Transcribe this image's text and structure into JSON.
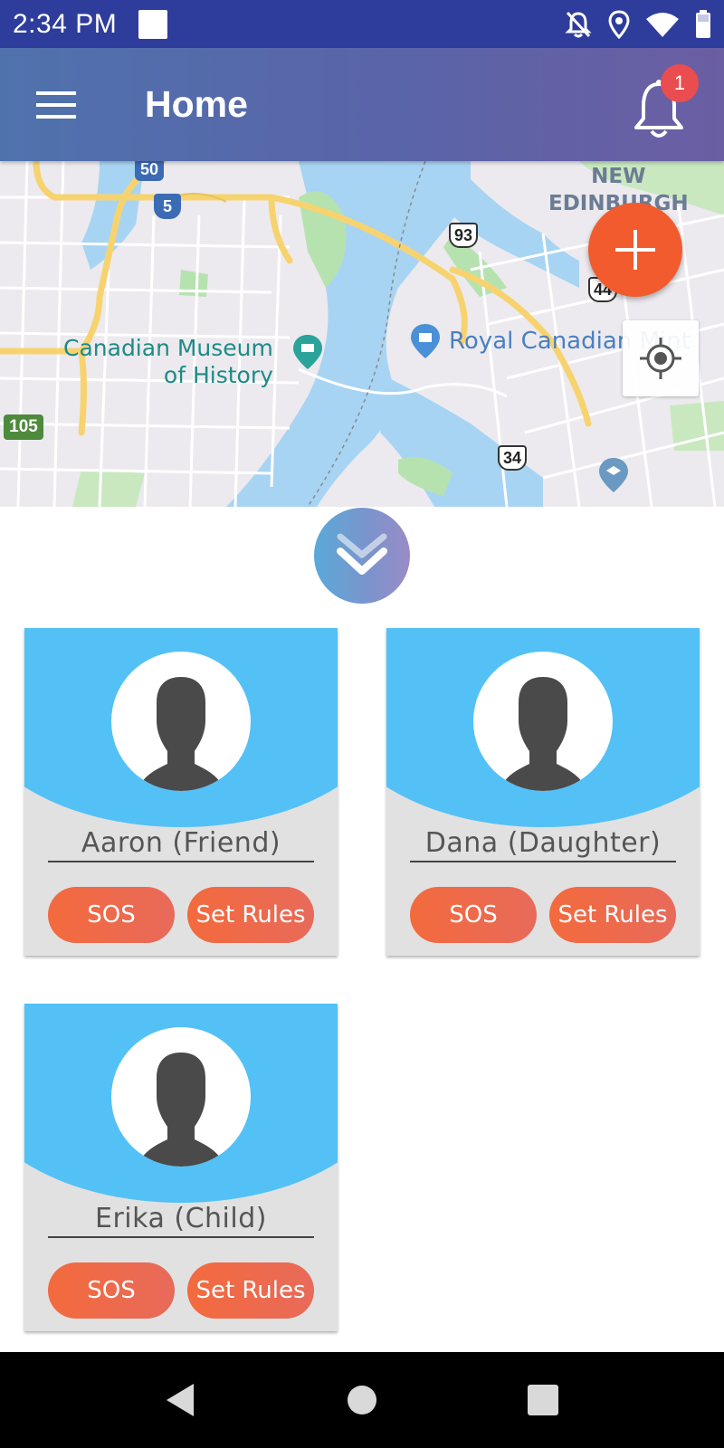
{
  "status_bar": {
    "time": "2:34 PM",
    "icons": [
      "notifications-off-icon",
      "location-icon",
      "wifi-icon",
      "battery-icon"
    ]
  },
  "app_bar": {
    "title": "Home",
    "notification_count": "1"
  },
  "map": {
    "labels": {
      "new_edinburgh": "NEW\nEDINBURGH",
      "museum": "Canadian Museum\nof History",
      "royal": "Royal Canadian Mint"
    },
    "highways": [
      "50",
      "5",
      "93",
      "44",
      "105",
      "34"
    ]
  },
  "contacts": [
    {
      "name": "Aaron (Friend)",
      "sos_label": "SOS",
      "rules_label": "Set Rules"
    },
    {
      "name": "Dana (Daughter)",
      "sos_label": "SOS",
      "rules_label": "Set Rules"
    },
    {
      "name": "Erika (Child)",
      "sos_label": "SOS",
      "rules_label": "Set Rules"
    }
  ],
  "colors": {
    "status_bar": "#2e3c9b",
    "card_header": "#53c1f6",
    "button_orange": "#f36a3d",
    "fab": "#f25b2e",
    "badge": "#ea4d4f"
  }
}
